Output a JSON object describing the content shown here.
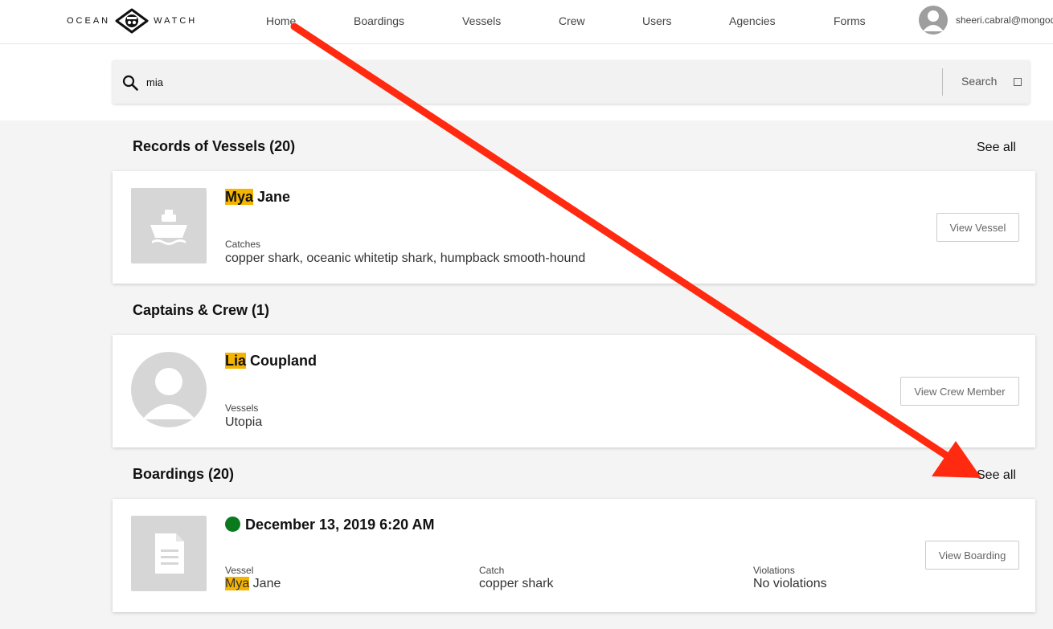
{
  "header": {
    "logo_left": "OCEAN",
    "logo_right": "WATCH",
    "nav": {
      "home": "Home",
      "boardings": "Boardings",
      "vessels": "Vessels",
      "crew": "Crew",
      "users": "Users",
      "agencies": "Agencies",
      "forms": "Forms"
    },
    "user_email": "sheeri.cabral@mongodb.com"
  },
  "search": {
    "value": "mia",
    "button_label": "Search"
  },
  "vessels": {
    "title": "Records of Vessels (20)",
    "see_all": "See all",
    "card": {
      "name_highlight": "Mya",
      "name_rest": " Jane",
      "field_label": "Catches",
      "field_value": "copper shark, oceanic whitetip shark, humpback smooth-hound",
      "button": "View Vessel"
    }
  },
  "crew": {
    "title": "Captains & Crew (1)",
    "card": {
      "name_highlight": "Lia",
      "name_rest": " Coupland",
      "field_label": "Vessels",
      "field_value": "Utopia",
      "button": "View Crew Member"
    }
  },
  "boardings": {
    "title": "Boardings (20)",
    "see_all": "See all",
    "card": {
      "date": "December 13, 2019 6:20 AM",
      "status_color": "#0a7a1e",
      "vessel_label": "Vessel",
      "vessel_highlight": "Mya",
      "vessel_rest": " Jane",
      "catch_label": "Catch",
      "catch_value": "copper shark",
      "violations_label": "Violations",
      "violations_value": "No violations",
      "button": "View Boarding"
    }
  },
  "icons": {
    "search": "search-icon",
    "ship": "ship-icon",
    "person": "person-icon",
    "document": "document-icon",
    "eye_logo": "eye-logo-icon",
    "annotation": "red-arrow-annotation"
  },
  "colors": {
    "highlight": "#f5b400",
    "annotation_arrow": "#ff2a10"
  }
}
